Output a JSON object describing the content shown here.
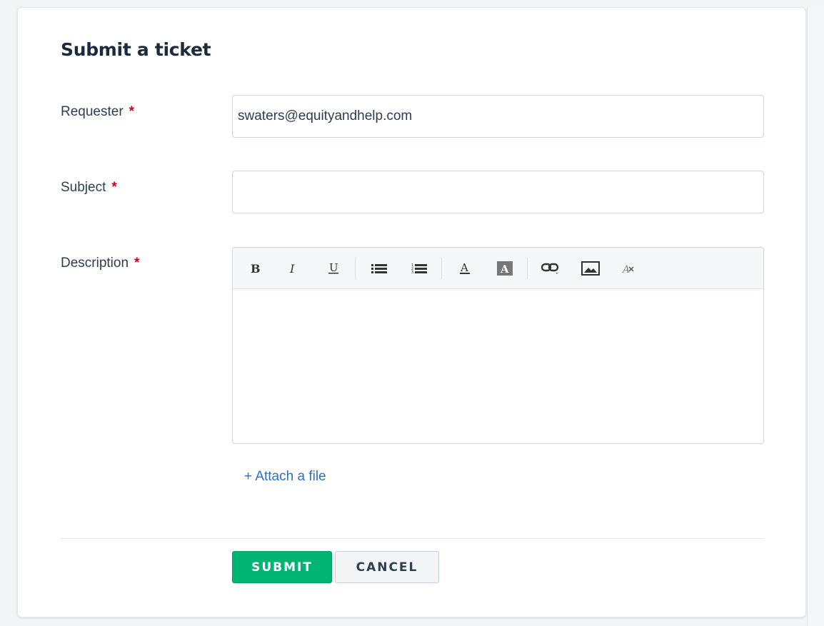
{
  "form": {
    "title": "Submit a ticket",
    "requester": {
      "label": "Requester",
      "required_mark": "*",
      "value": "swaters@equityandhelp.com"
    },
    "subject": {
      "label": "Subject",
      "required_mark": "*",
      "value": ""
    },
    "description": {
      "label": "Description",
      "required_mark": "*"
    },
    "toolbar": [
      "bold-icon",
      "italic-icon",
      "underline-icon",
      "bullet-list-icon",
      "numbered-list-icon",
      "font-color-icon",
      "background-color-icon",
      "link-icon",
      "image-icon",
      "clear-format-icon"
    ],
    "attach_label": "+ Attach a file",
    "submit_label": "SUBMIT",
    "cancel_label": "CANCEL"
  },
  "colors": {
    "submit_bg": "#00b473",
    "link": "#2c6ecb",
    "required": "#d0021b"
  }
}
